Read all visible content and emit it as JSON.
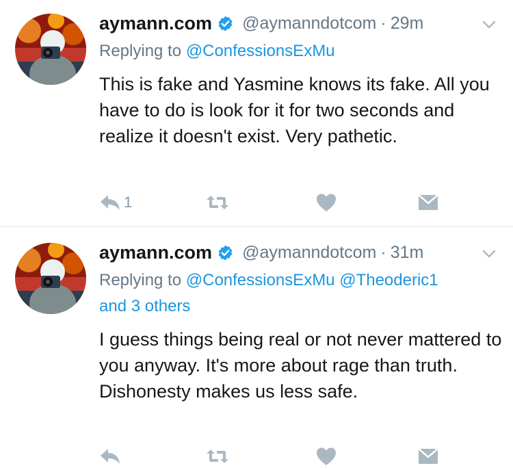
{
  "tweets": [
    {
      "display_name": "aymann.com",
      "handle": "@aymanndotcom",
      "separator": "·",
      "time": "29m",
      "replying_prefix": "Replying to",
      "mentions_line1": "@ConfessionsExMu",
      "mentions_line2": "",
      "text": "This is fake and Yasmine knows its fake. All you have to do is look for it for two seconds and realize it doesn't exist. Very pathetic.",
      "reply_count": "1"
    },
    {
      "display_name": "aymann.com",
      "handle": "@aymanndotcom",
      "separator": "·",
      "time": "31m",
      "replying_prefix": "Replying to",
      "mentions_line1": "@ConfessionsExMu @Theoderic1",
      "mentions_line2": "and 3 others",
      "text": "I guess things being real or not never mattered to you anyway. It's more about rage than truth. Dishonesty makes us less safe.",
      "reply_count": ""
    }
  ],
  "colors": {
    "name": "#14171a",
    "secondary": "#657786",
    "link": "#1b95e0",
    "verified": "#1da1f2",
    "icon": "#aab8c2"
  },
  "icons": [
    "verified-badge-icon",
    "chevron-down-icon",
    "reply-icon",
    "retweet-icon",
    "like-heart-icon",
    "direct-message-icon"
  ]
}
